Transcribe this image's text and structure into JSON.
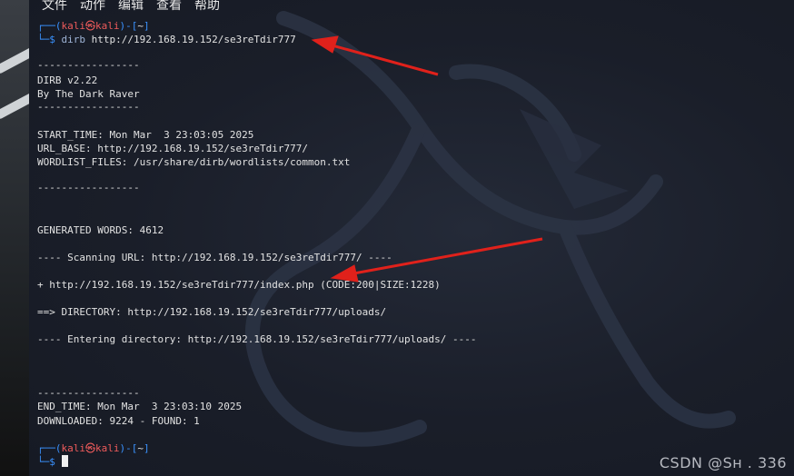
{
  "menu": [
    "文件",
    "动作",
    "编辑",
    "查看",
    "帮助"
  ],
  "prompt": {
    "user": "kali",
    "at": "㉿",
    "host": "kali",
    "dir": "~",
    "dollar": "$"
  },
  "command": {
    "cmd": "dirb",
    "arg": "http://192.168.19.152/se3reTdir777"
  },
  "output": {
    "sep_short": "-----------------",
    "version": "DIRB v2.22",
    "author": "By The Dark Raver",
    "start_time": "START_TIME: Mon Mar  3 23:03:05 2025",
    "url_base": "URL_BASE: http://192.168.19.152/se3reTdir777/",
    "wordlist": "WORDLIST_FILES: /usr/share/dirb/wordlists/common.txt",
    "sep_mid": "-----------------",
    "generated": "GENERATED WORDS: 4612",
    "scanning": "---- Scanning URL: http://192.168.19.152/se3reTdir777/ ----",
    "found": "+ http://192.168.19.152/se3reTdir777/index.php (CODE:200|SIZE:1228)",
    "directory": "==> DIRECTORY: http://192.168.19.152/se3reTdir777/uploads/",
    "entering": "---- Entering directory: http://192.168.19.152/se3reTdir777/uploads/ ----",
    "end_time": "END_TIME: Mon Mar  3 23:03:10 2025",
    "downloaded": "DOWNLOADED: 9224 - FOUND: 1"
  },
  "watermark": "CSDN @Sн    . 336",
  "colors": {
    "prompt_frame": "#3a92ff",
    "prompt_user": "#ef5b5b",
    "arrow": "#e0211b",
    "background": "#1b1f29"
  }
}
